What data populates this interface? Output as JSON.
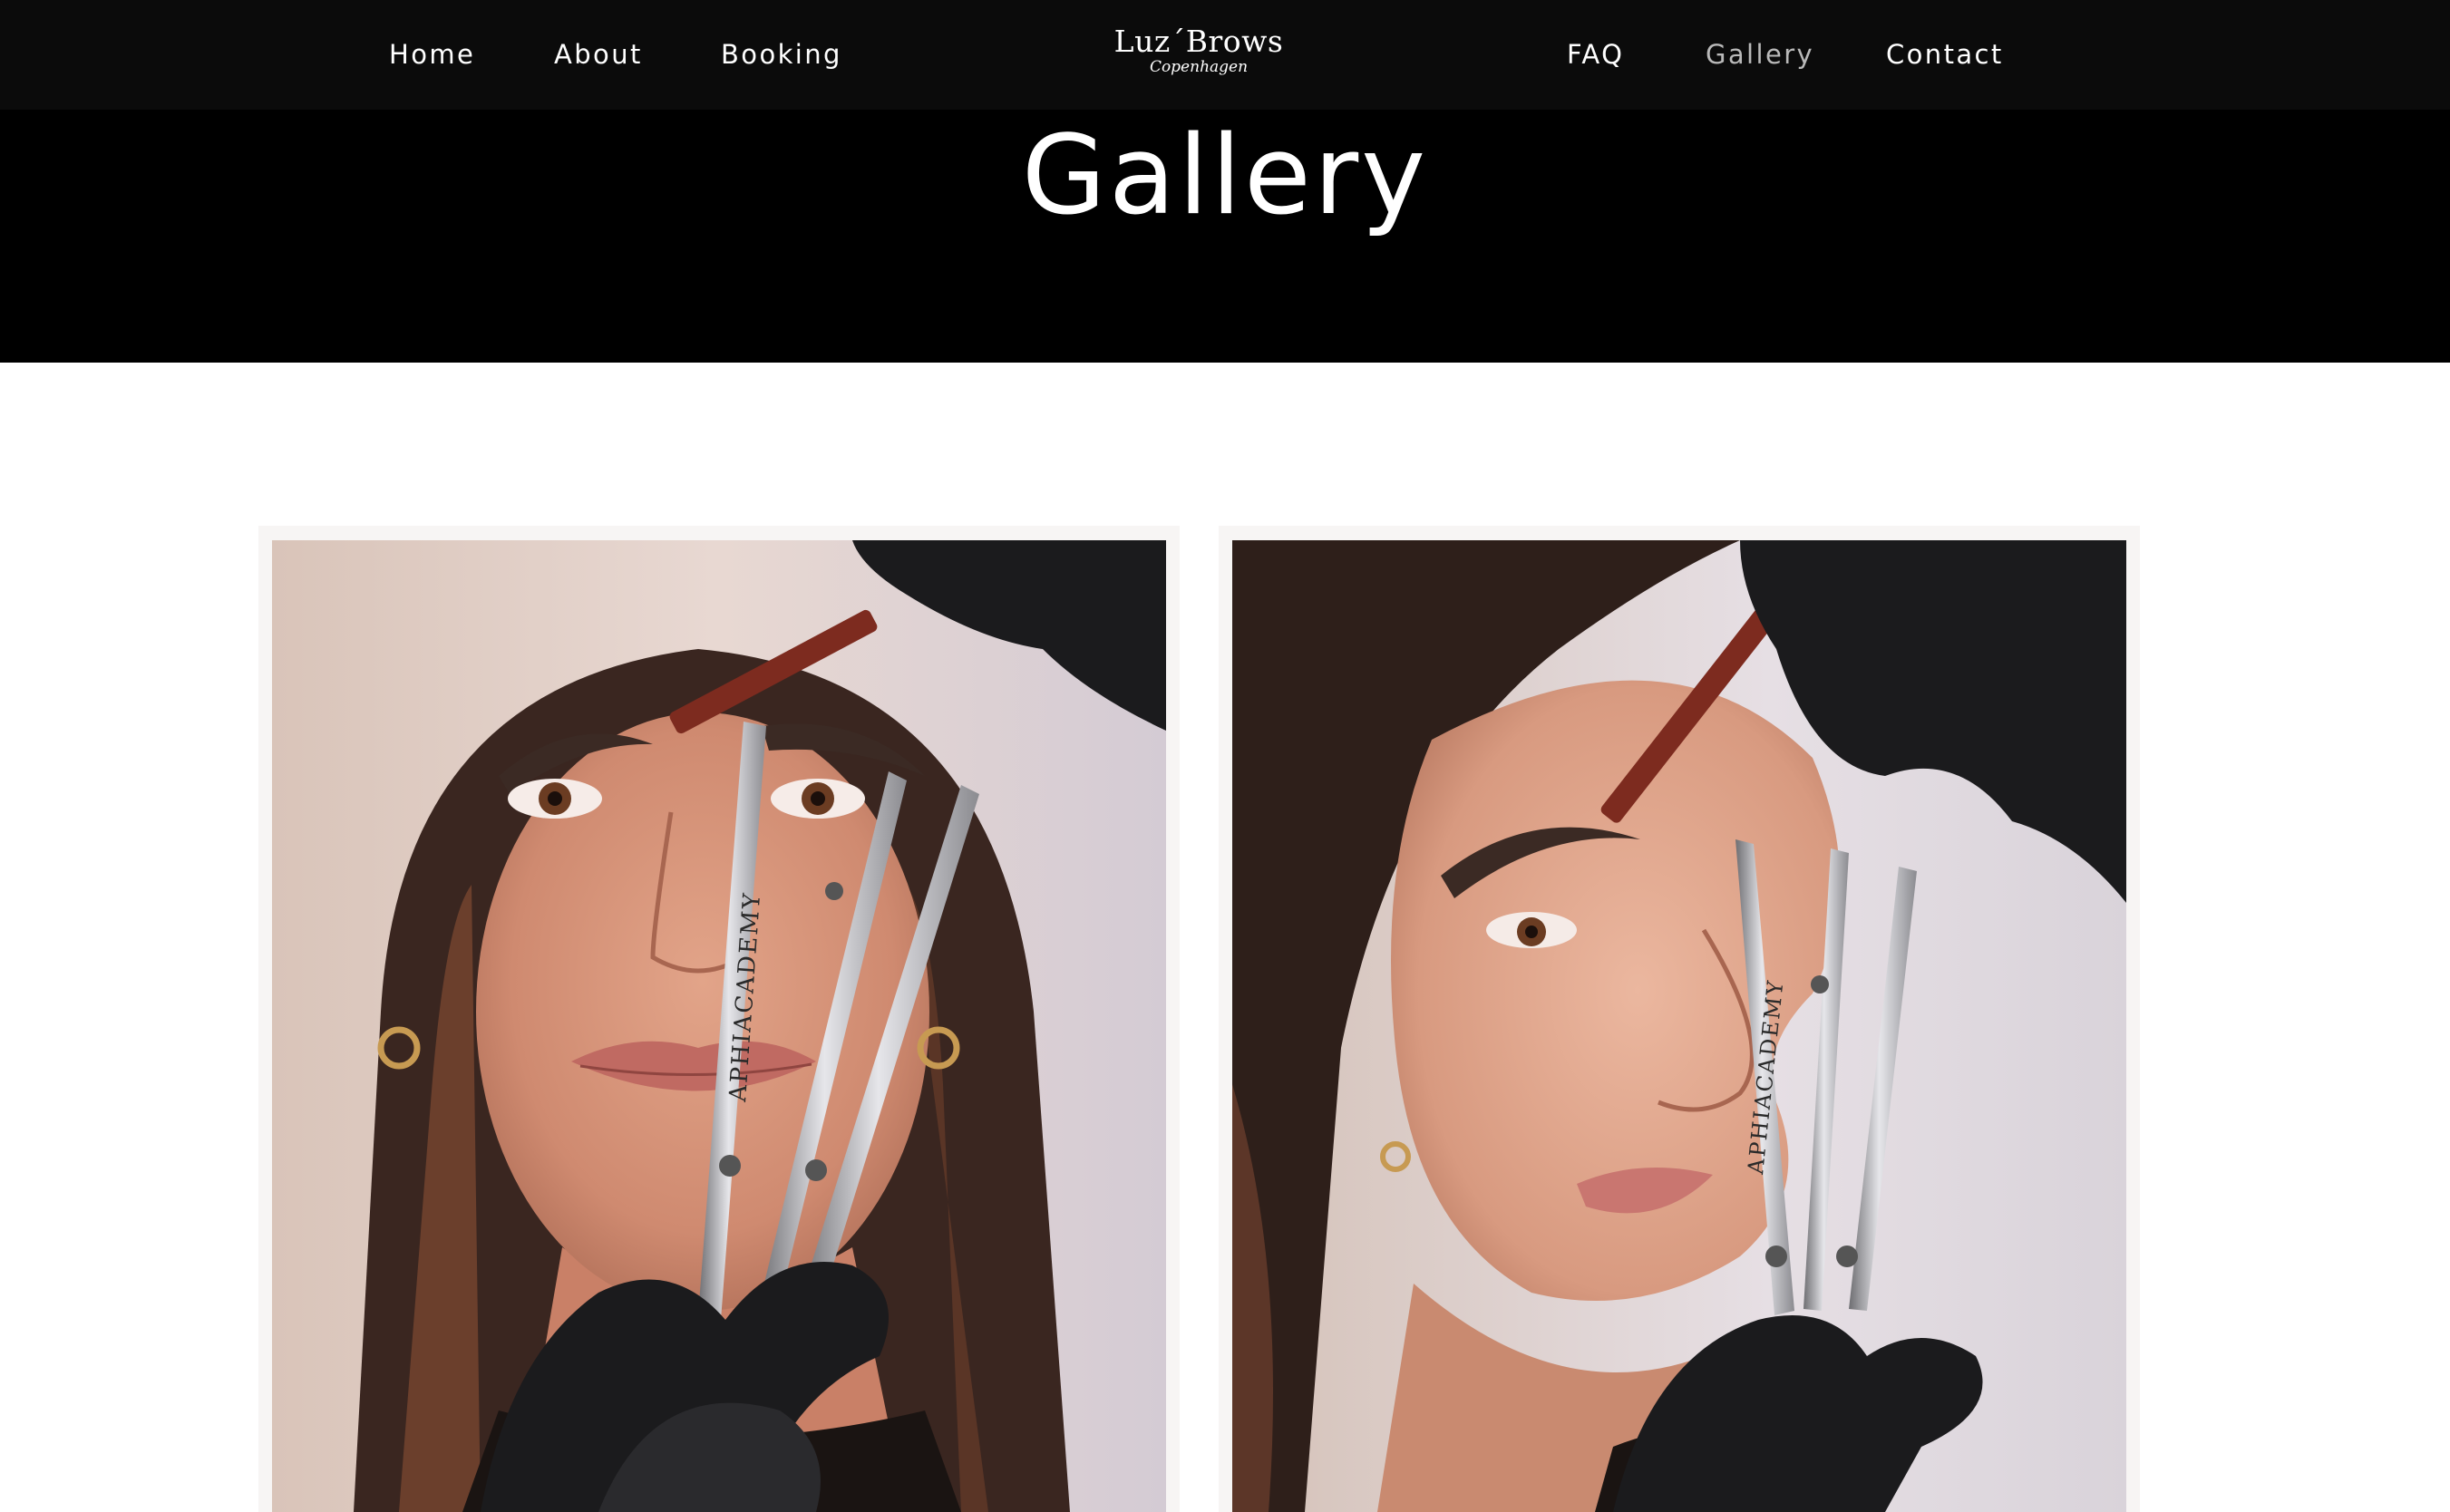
{
  "nav": {
    "left": [
      {
        "label": "Home"
      },
      {
        "label": "About"
      },
      {
        "label": "Booking"
      }
    ],
    "right": [
      {
        "label": "FAQ"
      },
      {
        "label": "Gallery",
        "active": true
      },
      {
        "label": "Contact"
      }
    ]
  },
  "logo": {
    "main": "Luz´Brows",
    "sub": "Copenhagen"
  },
  "hero": {
    "title": "Gallery"
  },
  "gallery": {
    "items": [
      {
        "name": "brow-mapping-front-photo",
        "caliper_text": "APHIACADEMY"
      },
      {
        "name": "brow-mapping-side-photo",
        "caliper_text": "APHIACADEMY"
      }
    ]
  },
  "colors": {
    "header_bg": "#0b0b0b",
    "hero_bg": "#000000",
    "nav_text": "#ffffff",
    "nav_active": "#b9b9b9",
    "card_bg": "#f7f5f4"
  }
}
